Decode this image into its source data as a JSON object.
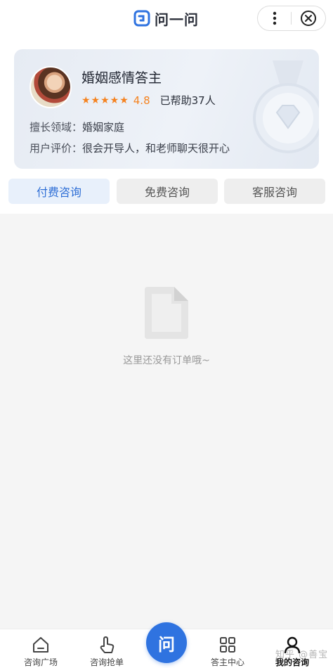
{
  "app": {
    "title": "问一问"
  },
  "profile": {
    "name": "婚姻感情答主",
    "stars": "★★★★★",
    "rating": "4.8",
    "helped": "已帮助37人",
    "specialty_label": "擅长领域：",
    "specialty_value": "婚姻家庭",
    "review_label": "用户评价：",
    "review_value": "很会开导人，和老师聊天很开心"
  },
  "tabs": [
    {
      "label": "付费咨询",
      "active": true
    },
    {
      "label": "免费咨询",
      "active": false
    },
    {
      "label": "客服咨询",
      "active": false
    }
  ],
  "empty_state": {
    "text": "这里还没有订单哦~"
  },
  "bottom_nav": {
    "items": [
      {
        "label": "咨询广场",
        "icon": "home-icon"
      },
      {
        "label": "咨询抢单",
        "icon": "tap-hand-icon"
      },
      {
        "label": "问",
        "icon": "ask-button"
      },
      {
        "label": "答主中心",
        "icon": "grid-icon"
      },
      {
        "label": "我的咨询",
        "icon": "user-icon",
        "active": true
      }
    ]
  },
  "watermark": "知乎 @善宝",
  "colors": {
    "accent": "#2f73e0",
    "star": "#f5821f",
    "active_tab_bg": "#e8f0fb",
    "content_bg": "#f5f5f5"
  }
}
